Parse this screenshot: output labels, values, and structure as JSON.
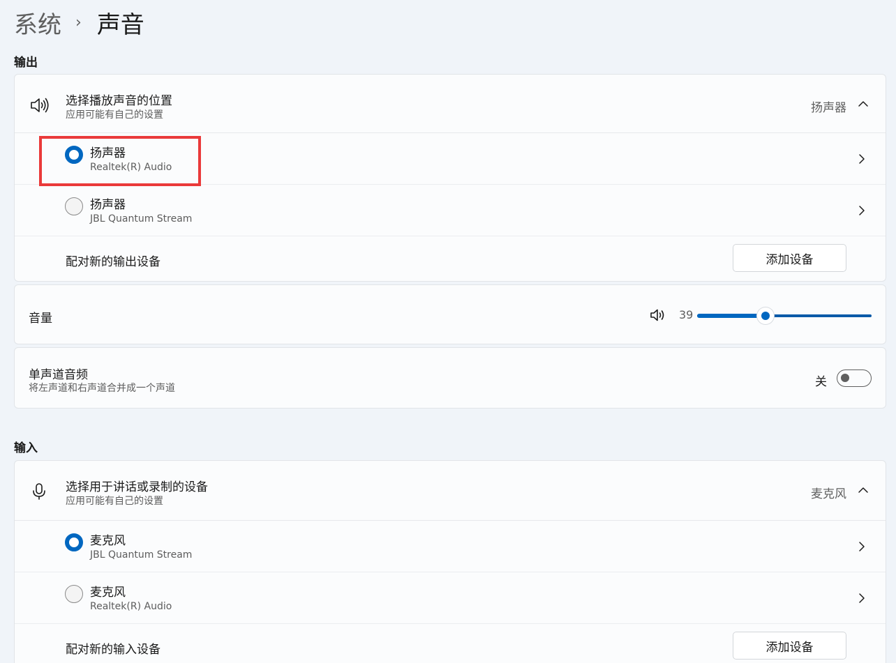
{
  "breadcrumb": {
    "parent": "系统",
    "separator": "›",
    "current": "声音"
  },
  "output": {
    "section_label": "输出",
    "header": {
      "title": "选择播放声音的位置",
      "subtitle": "应用可能有自己的设置",
      "current_value": "扬声器",
      "icon": "speaker-icon"
    },
    "devices": [
      {
        "name": "扬声器",
        "description": "Realtek(R) Audio",
        "selected": true
      },
      {
        "name": "扬声器",
        "description": "JBL Quantum Stream",
        "selected": false
      }
    ],
    "pair": {
      "label": "配对新的输出设备",
      "button_label": "添加设备"
    }
  },
  "volume": {
    "label": "音量",
    "value": "39",
    "level": 0.39,
    "icon": "speaker-icon"
  },
  "mono_audio": {
    "title": "单声道音频",
    "subtitle": "将左声道和右声道合并成一个声道",
    "state_label": "关",
    "enabled": false
  },
  "input": {
    "section_label": "输入",
    "header": {
      "title": "选择用于讲话或录制的设备",
      "subtitle": "应用可能有自己的设置",
      "current_value": "麦克风",
      "icon": "microphone-icon"
    },
    "devices": [
      {
        "name": "麦克风",
        "description": "JBL Quantum Stream",
        "selected": true
      },
      {
        "name": "麦克风",
        "description": "Realtek(R) Audio",
        "selected": false
      }
    ],
    "pair": {
      "label": "配对新的输入设备",
      "button_label": "添加设备"
    }
  },
  "colors": {
    "accent": "#0067c0",
    "highlight": "#ea3a3a",
    "background": "#f0f4f9"
  }
}
